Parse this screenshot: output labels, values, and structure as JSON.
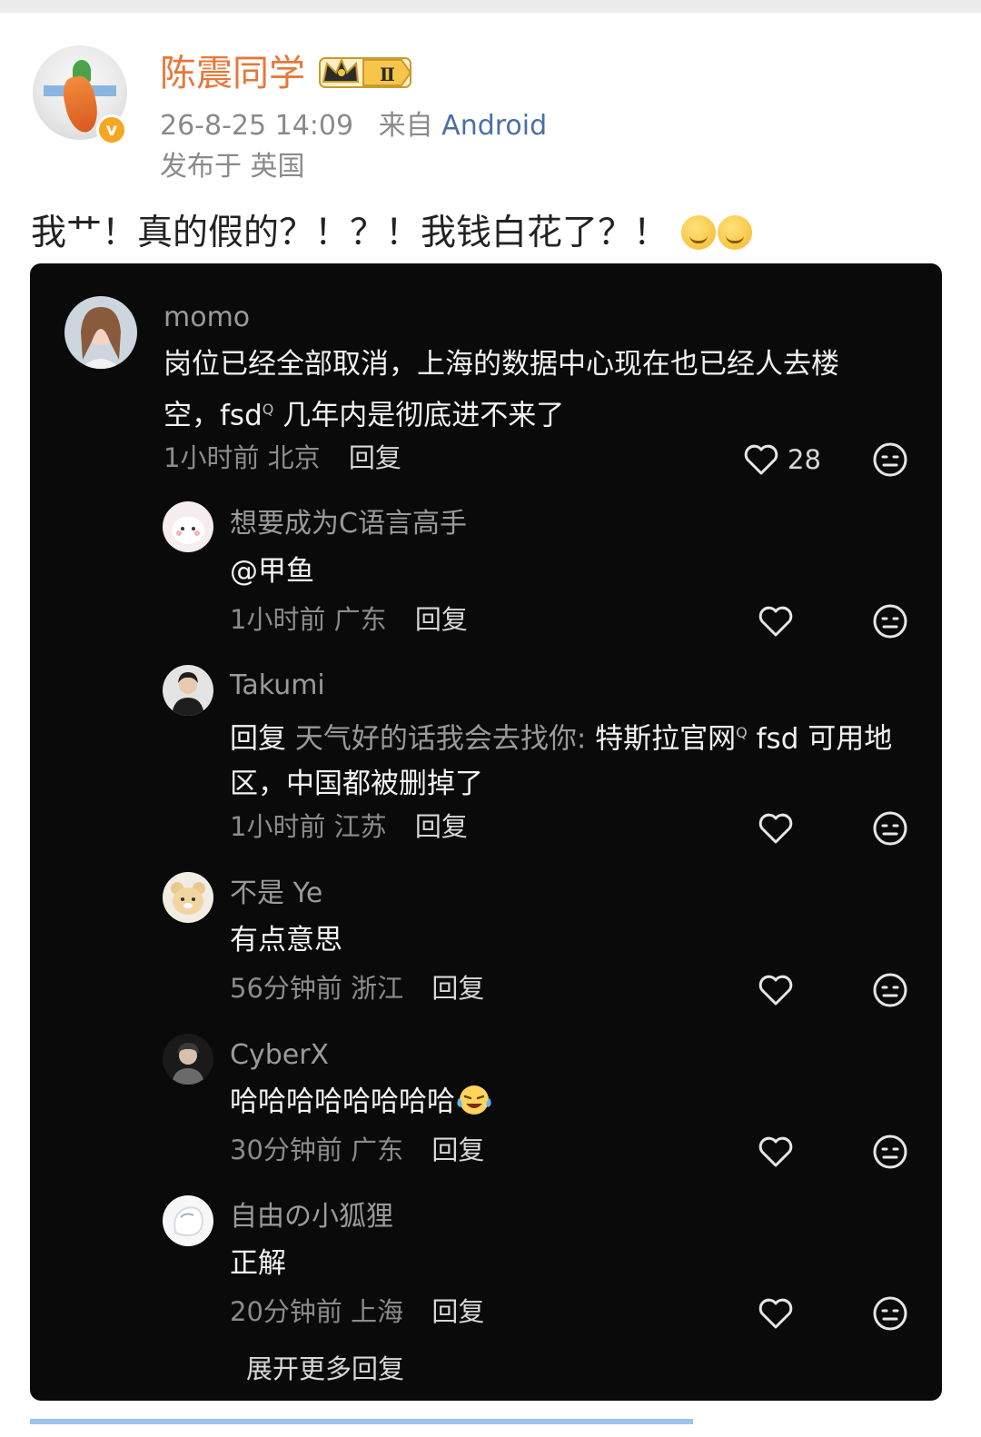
{
  "post": {
    "author": "陈震同学",
    "level_badge": "Ⅱ",
    "timestamp": "26-8-25 14:09",
    "source_prefix": "来自",
    "source": "Android",
    "location": "发布于 英国",
    "text": "我艹！真的假的？！？！我钱白花了？！",
    "emojis": [
      "sweat-smile-emoji",
      "sweat-smile-emoji"
    ]
  },
  "comments": [
    {
      "name": "momo",
      "text": "岗位已经全部取消，上海的数据中心现在也已经人去楼空，fsd",
      "text_tail": "几年内是彻底进不来了",
      "time": "1小时前",
      "region": "北京",
      "reply_label": "回复",
      "likes": "28"
    },
    {
      "name": "想要成为C语言高手",
      "text": "@甲鱼",
      "time": "1小时前",
      "region": "广东",
      "reply_label": "回复"
    },
    {
      "name": "Takumi",
      "reply_prefix": "回复",
      "reply_target": "天气好的话我会去找你:",
      "text": "特斯拉官网",
      "text_tail": "fsd 可用地区，中国都被删掉了",
      "time": "1小时前",
      "region": "江苏",
      "reply_label": "回复"
    },
    {
      "name": "不是 Ye",
      "text": "有点意思",
      "time": "56分钟前",
      "region": "浙江",
      "reply_label": "回复"
    },
    {
      "name": "CyberX",
      "text": "哈哈哈哈哈哈哈哈",
      "time": "30分钟前",
      "region": "广东",
      "reply_label": "回复"
    },
    {
      "name": "自由の小狐狸",
      "text": "正解",
      "time": "20分钟前",
      "region": "上海",
      "reply_label": "回复"
    }
  ],
  "more_replies_label": "展开更多回复",
  "colors": {
    "author": "#e8773a",
    "source_link": "#4a6fa5",
    "dark_bg": "#0a0a0a",
    "vip_badge": "#f5a623"
  }
}
